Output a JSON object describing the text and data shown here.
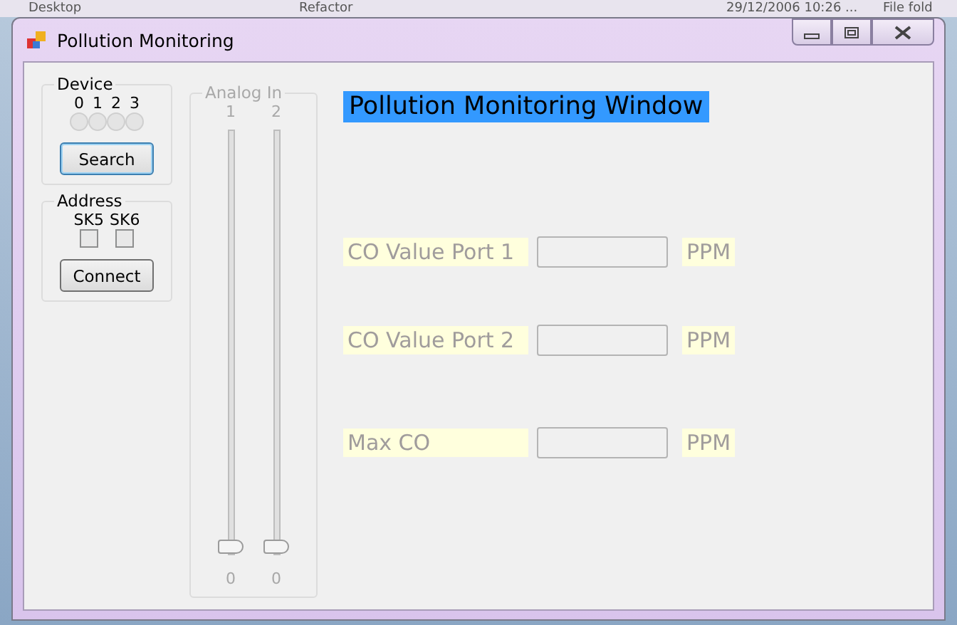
{
  "background": {
    "texts": [
      "Desktop",
      "Refactor",
      "29/12/2006 10:26 ...",
      "File fold"
    ]
  },
  "window": {
    "title": "Pollution Monitoring"
  },
  "device": {
    "title": "Device",
    "leds": [
      {
        "label": "0",
        "on": false
      },
      {
        "label": "1",
        "on": false
      },
      {
        "label": "2",
        "on": false
      },
      {
        "label": "3",
        "on": false
      }
    ],
    "button": "Search"
  },
  "address": {
    "title": "Address",
    "checkboxes": [
      {
        "label": "SK5",
        "checked": false
      },
      {
        "label": "SK6",
        "checked": false
      }
    ],
    "button": "Connect"
  },
  "analog": {
    "title": "Analog In",
    "channels": [
      {
        "label": "1",
        "level": 0,
        "reading": "0"
      },
      {
        "label": "2",
        "level": 0,
        "reading": "0"
      }
    ]
  },
  "heading": "Pollution Monitoring Window",
  "readings": [
    {
      "label": "CO Value Port 1",
      "unit": "PPM"
    },
    {
      "label": "CO Value Port 2",
      "unit": "PPM"
    },
    {
      "label": "Max CO",
      "unit": "PPM"
    }
  ]
}
